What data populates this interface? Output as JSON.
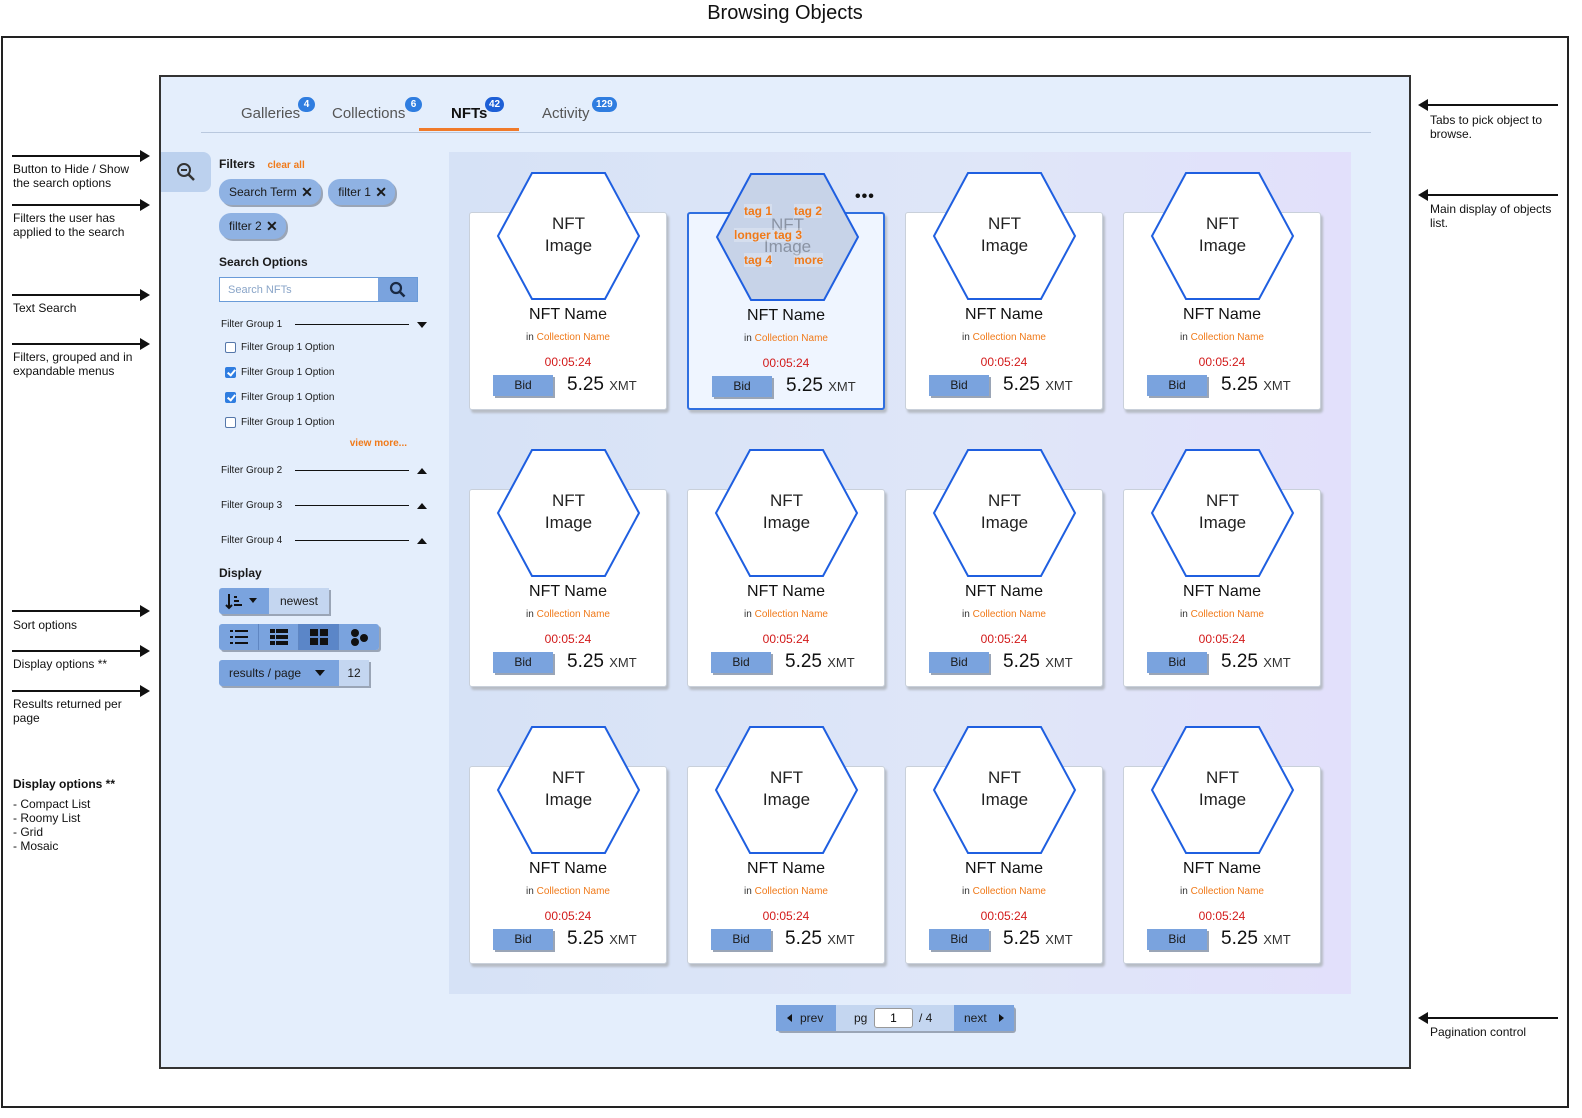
{
  "title": "Browsing Objects",
  "left_annotations": {
    "hide_show": "Button to Hide / Show the search options",
    "applied_filters": "Filters the user has applied to the search",
    "text_search": "Text Search",
    "filter_groups": "Filters, grouped and in expandable menus",
    "sort": "Sort options",
    "display": "Display options **",
    "results": "Results returned per page",
    "note_title": "Display options **",
    "note_items": [
      "- Compact List",
      "- Roomy List",
      "- Grid",
      "- Mosaic"
    ]
  },
  "right_annotations": {
    "tabs": "Tabs to pick object to browse.",
    "main": "Main display of objects list.",
    "pagination": "Pagination control"
  },
  "tabs": [
    {
      "label": "Galleries",
      "count": "4"
    },
    {
      "label": "Collections",
      "count": "6"
    },
    {
      "label": "NFTs",
      "count": "42"
    },
    {
      "label": "Activity",
      "count": "129"
    }
  ],
  "sidebar": {
    "filters_label": "Filters",
    "clear_all": "clear all",
    "chips": [
      "Search Term",
      "filter 1",
      "filter 2"
    ],
    "search_options_label": "Search Options",
    "search_placeholder": "Search NFTs",
    "filter_groups": [
      {
        "label": "Filter Group 1",
        "expanded": true
      },
      {
        "label": "Filter Group 2",
        "expanded": false
      },
      {
        "label": "Filter Group 3",
        "expanded": false
      },
      {
        "label": "Filter Group 4",
        "expanded": false
      }
    ],
    "options": [
      {
        "label": "Filter Group 1 Option",
        "checked": false
      },
      {
        "label": "Filter Group 1 Option",
        "checked": true
      },
      {
        "label": "Filter Group 1 Option",
        "checked": true
      },
      {
        "label": "Filter Group 1 Option",
        "checked": false
      }
    ],
    "view_more": "view more...",
    "display_label": "Display",
    "sort_value": "newest",
    "display_modes": [
      "compact-list",
      "roomy-list",
      "grid",
      "mosaic"
    ],
    "display_active": "grid",
    "rpp_label": "results / page",
    "rpp_value": "12"
  },
  "card": {
    "image_line1": "NFT",
    "image_line2": "Image",
    "name": "NFT Name",
    "in": "in",
    "collection": "Collection Name",
    "timer": "00:05:24",
    "bid": "Bid",
    "price": "5.25",
    "currency": "XMT"
  },
  "hover_tags": [
    "tag 1",
    "tag 2",
    "longer tag 3",
    "tag 4",
    "more"
  ],
  "more_dots": "•••",
  "pagination": {
    "prev": "prev",
    "pg": "pg",
    "page": "1",
    "total": "/ 4",
    "next": "next"
  },
  "colors": {
    "accent": "#f07a1a",
    "primary": "#2f7de0",
    "timer": "#d21a1a",
    "button": "#7aa3de"
  }
}
